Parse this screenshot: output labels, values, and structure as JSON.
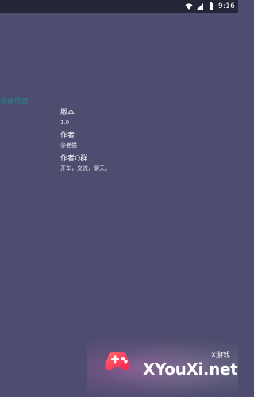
{
  "status_bar": {
    "time": "9:16",
    "icons": [
      "wifi-icon",
      "signal-icon",
      "battery-icon"
    ]
  },
  "side_label": "设备信息",
  "info": {
    "version": {
      "title": "版本",
      "value": "1.0"
    },
    "author": {
      "title": "作者",
      "value": "@老猫"
    },
    "author_group": {
      "title": "作者Q群",
      "value": "开车，交流，聊天。"
    }
  },
  "watermark": {
    "badge": "X游戏",
    "site": "XYouXi.net",
    "logo_icon": "gamepad-icon"
  },
  "colors": {
    "background": "#4f4d6f",
    "status_bar": "#242638",
    "side_label": "#1c8b88",
    "watermark_accent": "#ff3b5c"
  }
}
